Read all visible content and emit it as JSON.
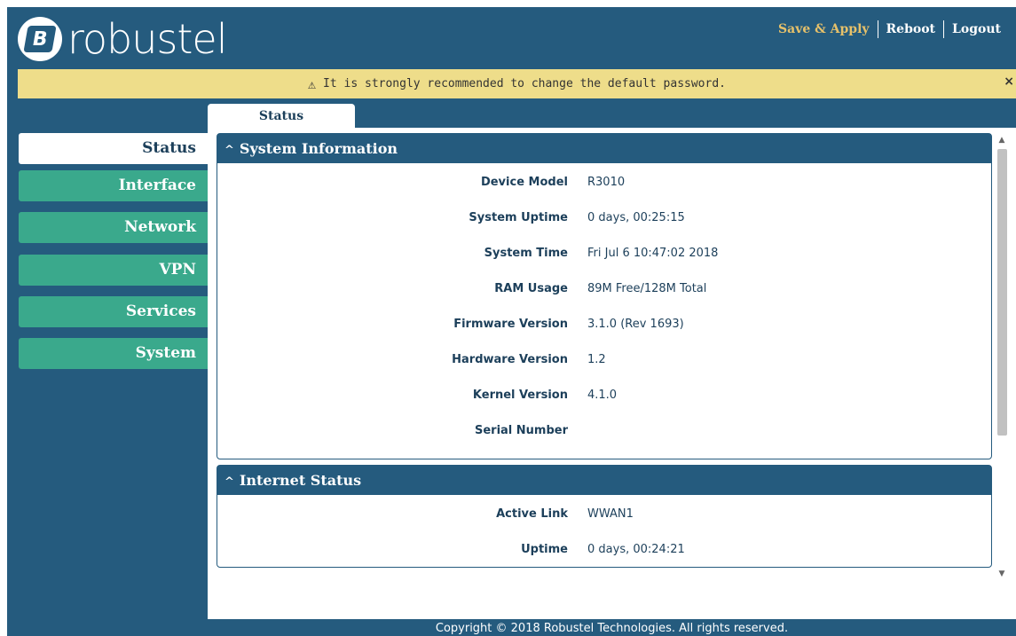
{
  "header": {
    "logo_glyph": "B",
    "logo_text": "robustel",
    "actions": {
      "save_apply": "Save & Apply",
      "reboot": "Reboot",
      "logout": "Logout"
    }
  },
  "banner": {
    "icon": "warning-icon",
    "icon_glyph": "⚠",
    "text": "It is strongly recommended to change the default password.",
    "close_glyph": "×"
  },
  "sidebar": {
    "items": [
      {
        "label": "Status",
        "active": true
      },
      {
        "label": "Interface"
      },
      {
        "label": "Network"
      },
      {
        "label": "VPN"
      },
      {
        "label": "Services"
      },
      {
        "label": "System"
      }
    ]
  },
  "tabs": [
    {
      "label": "Status",
      "active": true
    }
  ],
  "panels": {
    "system_info": {
      "title": "System Information",
      "chevron": "^",
      "rows": [
        {
          "label": "Device Model",
          "value": "R3010"
        },
        {
          "label": "System Uptime",
          "value": "0 days, 00:25:15"
        },
        {
          "label": "System Time",
          "value": "Fri Jul 6 10:47:02 2018"
        },
        {
          "label": "RAM Usage",
          "value": "89M Free/128M Total"
        },
        {
          "label": "Firmware Version",
          "value": "3.1.0 (Rev 1693)"
        },
        {
          "label": "Hardware Version",
          "value": "1.2"
        },
        {
          "label": "Kernel Version",
          "value": "4.1.0"
        },
        {
          "label": "Serial Number",
          "value": ""
        }
      ]
    },
    "internet_status": {
      "title": "Internet Status",
      "chevron": "^",
      "rows": [
        {
          "label": "Active Link",
          "value": "WWAN1"
        },
        {
          "label": "Uptime",
          "value": "0 days, 00:24:21"
        }
      ]
    }
  },
  "scrollbar": {
    "up_glyph": "▲",
    "down_glyph": "▼"
  },
  "footer": {
    "text": "Copyright © 2018 Robustel Technologies. All rights reserved."
  },
  "colors": {
    "header_bg": "#255b7e",
    "accent": "#3aa98c",
    "banner_bg": "#eedd8a",
    "save_apply": "#e6c16a"
  }
}
